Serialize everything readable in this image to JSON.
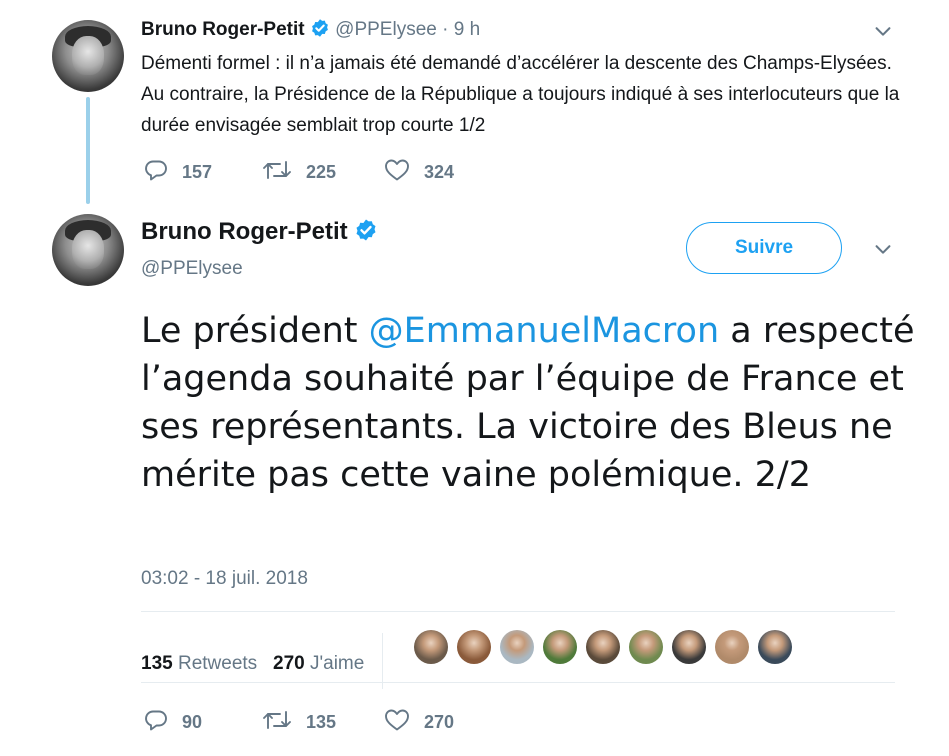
{
  "tweet1": {
    "author_name": "Bruno Roger-Petit",
    "handle": "@PPElysee",
    "dot": "·",
    "time": "9 h",
    "text": "Démenti formel : il n’a jamais été demandé d’accélérer la descente des Champs-Elysées. Au contraire, la Présidence de la République a toujours indiqué à ses interlocuteurs que la durée envisagée semblait trop courte 1/2",
    "replies": "157",
    "retweets": "225",
    "likes": "324"
  },
  "tweet2": {
    "author_name": "Bruno Roger-Petit",
    "handle": "@PPElysee",
    "follow_label": "Suivre",
    "text_before": "Le président ",
    "mention": "@EmmanuelMacron",
    "text_after": " a respecté l’agenda souhaité par l’équipe de France et ses représentants. La victoire des Bleus ne mérite pas cette vaine polémique. 2/2",
    "timestamp": "03:02 - 18 juil. 2018",
    "retweet_count": "135",
    "retweet_label": "Retweets",
    "like_count": "270",
    "like_label": "J'aime",
    "replies": "90",
    "retweets": "135",
    "likes": "270"
  },
  "icons": {
    "verified": "verified-badge-icon",
    "caret": "chevron-down-icon",
    "reply": "reply-icon",
    "retweet": "retweet-icon",
    "like": "heart-icon"
  },
  "colors": {
    "accent": "#1da1f2",
    "mention": "#1b95e0",
    "muted": "#657786",
    "thread_line": "#9bd0ea"
  },
  "likers": [
    {
      "name": "liker-avatar-1",
      "bg": "#6b5a4a"
    },
    {
      "name": "liker-avatar-2",
      "bg": "#8a5a3a"
    },
    {
      "name": "liker-avatar-3",
      "bg": "#aab8c2"
    },
    {
      "name": "liker-avatar-4",
      "bg": "#4f7a3a"
    },
    {
      "name": "liker-avatar-5",
      "bg": "#5a4a3a"
    },
    {
      "name": "liker-avatar-6",
      "bg": "#6f8a4f"
    },
    {
      "name": "liker-avatar-7",
      "bg": "#3a3a3a"
    },
    {
      "name": "liker-avatar-8",
      "bg": "#b08a6a"
    },
    {
      "name": "liker-avatar-9",
      "bg": "#3a4a5a"
    }
  ]
}
